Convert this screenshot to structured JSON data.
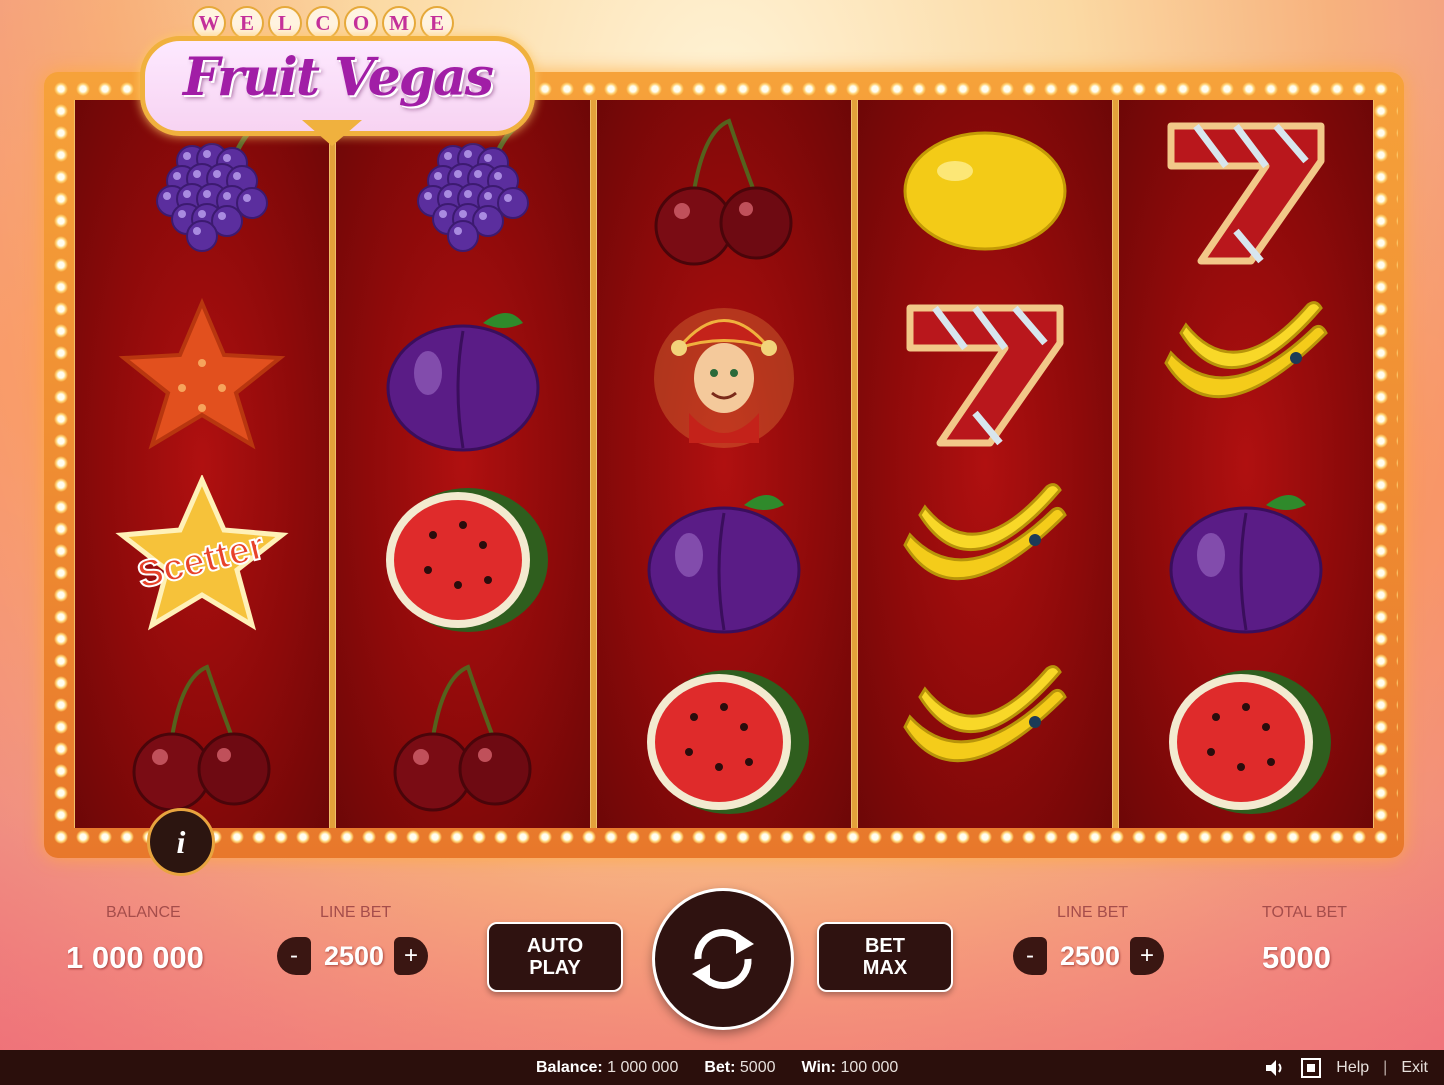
{
  "sign": {
    "welcome_letters": [
      "W",
      "E",
      "L",
      "C",
      "O",
      "M",
      "E"
    ],
    "title": "Fruit Vegas"
  },
  "reels": [
    [
      "grapes",
      "star",
      "scatter",
      "cherry"
    ],
    [
      "grapes",
      "plum",
      "watermelon",
      "cherry"
    ],
    [
      "cherry",
      "joker",
      "plum",
      "watermelon"
    ],
    [
      "lemon",
      "seven",
      "banana",
      "banana"
    ],
    [
      "seven",
      "banana",
      "plum",
      "watermelon"
    ]
  ],
  "scatter_label": "Scetter",
  "info_label": "i",
  "controls": {
    "balance_label": "BALANCE",
    "balance_value": "1 000 000",
    "line_bet_label": "LINE BET",
    "line_bet_value": "2500",
    "minus": "-",
    "plus": "+",
    "auto_play": "AUTO\nPLAY",
    "bet_max": "BET\nMAX",
    "total_bet_label": "TOTAL BET",
    "total_bet_value": "5000"
  },
  "status": {
    "balance_label": "Balance:",
    "balance_value": "1 000 000",
    "bet_label": "Bet:",
    "bet_value": "5000",
    "win_label": "Win:",
    "win_value": "100 000",
    "help": "Help",
    "separator": "|",
    "exit": "Exit"
  },
  "colors": {
    "reel_red": "#8d0a0a",
    "frame_gold": "#f0a23a",
    "button_dark": "#2f1210"
  }
}
